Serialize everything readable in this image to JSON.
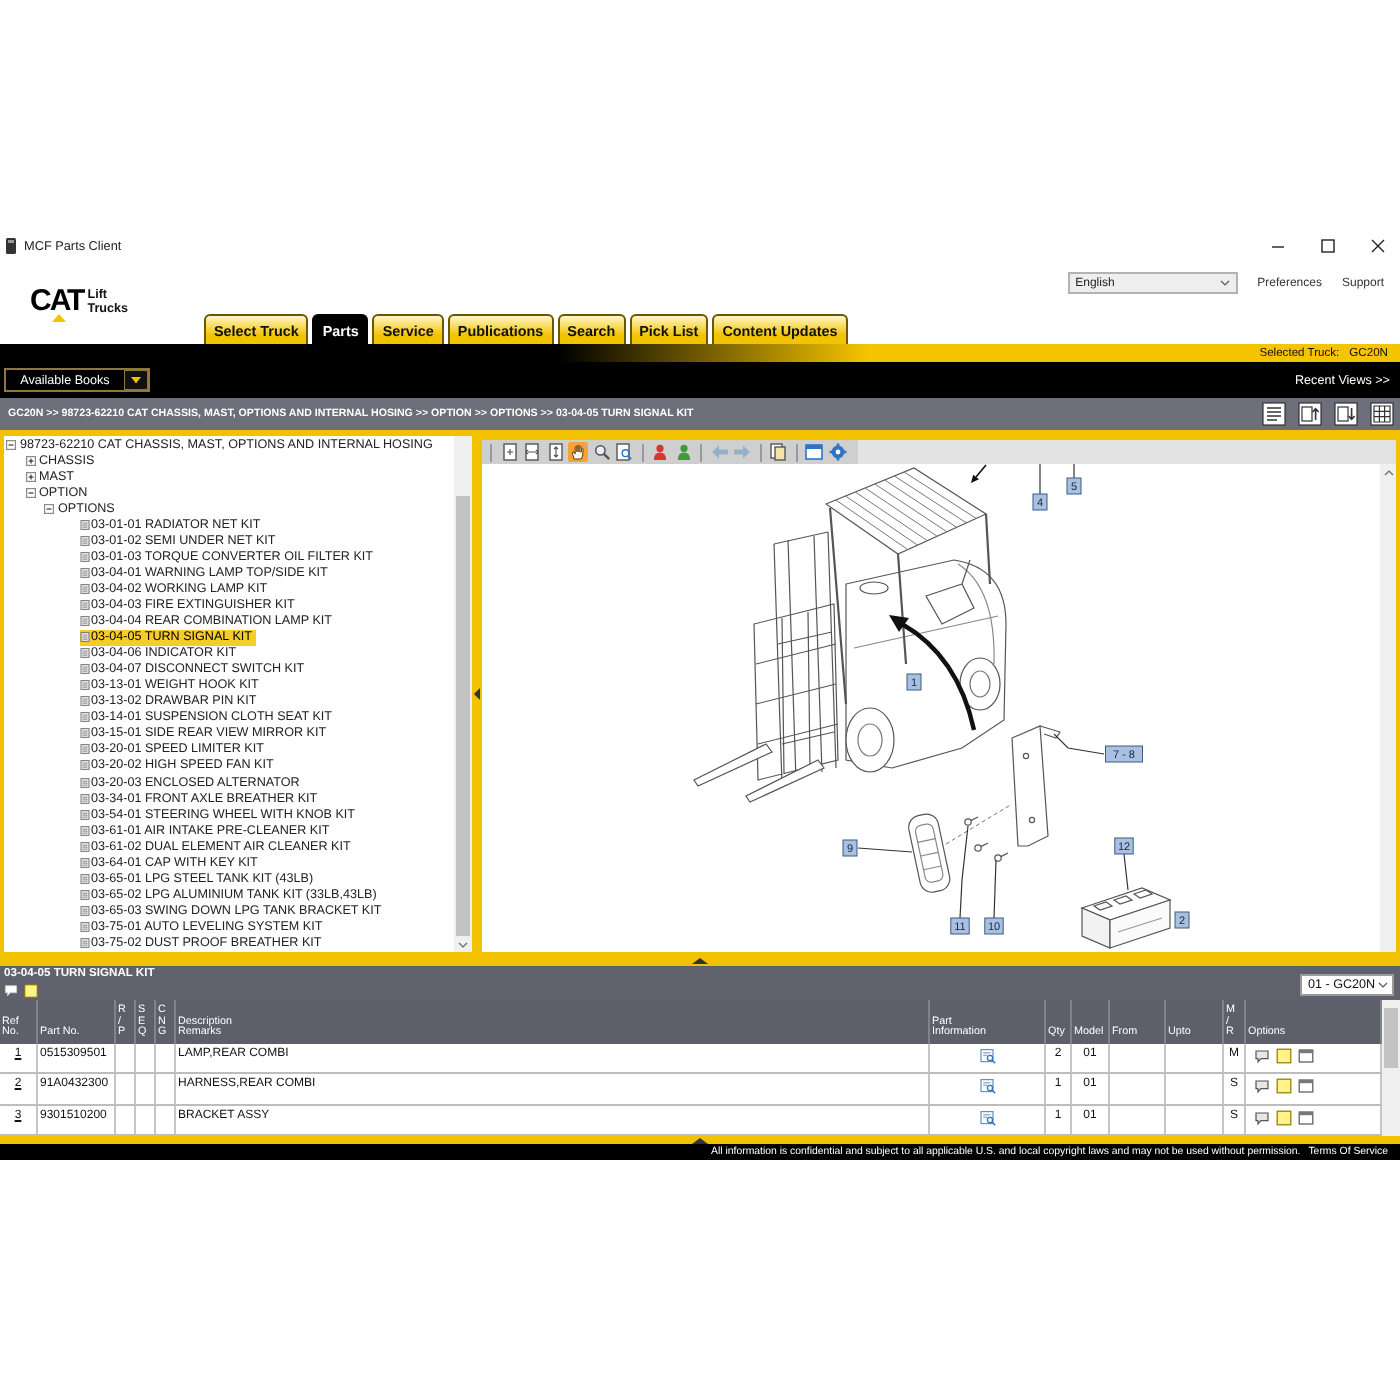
{
  "window": {
    "title": "MCF Parts Client"
  },
  "header": {
    "logo": {
      "mark": "CAT",
      "lines": [
        "Lift",
        "Trucks"
      ]
    },
    "language": "English",
    "links": [
      "Preferences",
      "Support"
    ]
  },
  "tabs": [
    {
      "label": "Select Truck",
      "selected": false
    },
    {
      "label": "Parts",
      "selected": true
    },
    {
      "label": "Service",
      "selected": false
    },
    {
      "label": "Publications",
      "selected": false
    },
    {
      "label": "Search",
      "selected": false
    },
    {
      "label": "Pick List",
      "selected": false
    },
    {
      "label": "Content Updates",
      "selected": false
    }
  ],
  "selected_truck": {
    "label": "Selected Truck:",
    "value": "GC20N"
  },
  "books_dropdown": {
    "label": "Available Books"
  },
  "recent_views": "Recent Views >>",
  "breadcrumb": "GC20N >> 98723-62210 CAT CHASSIS, MAST, OPTIONS AND INTERNAL HOSING >> OPTION >> OPTIONS >> 03-04-05 TURN SIGNAL KIT",
  "tree": [
    {
      "kind": "folder",
      "label": "98723-62210 CAT CHASSIS, MAST, OPTIONS AND INTERNAL HOSING",
      "expanded": true,
      "selected": false,
      "children": [
        {
          "kind": "folder",
          "label": "CHASSIS",
          "expanded": false,
          "selected": false
        },
        {
          "kind": "folder",
          "label": "MAST",
          "expanded": false,
          "selected": false
        },
        {
          "kind": "folder",
          "label": "OPTION",
          "expanded": true,
          "selected": false,
          "children": [
            {
              "kind": "folder",
              "label": "OPTIONS",
              "expanded": true,
              "selected": false,
              "children": [
                {
                  "kind": "item",
                  "label": "03-01-01 RADIATOR NET KIT",
                  "selected": false
                },
                {
                  "kind": "item",
                  "label": "03-01-02 SEMI UNDER NET KIT",
                  "selected": false
                },
                {
                  "kind": "item",
                  "label": "03-01-03 TORQUE CONVERTER OIL FILTER KIT",
                  "selected": false
                },
                {
                  "kind": "item",
                  "label": "03-04-01 WARNING LAMP TOP/SIDE KIT",
                  "selected": false
                },
                {
                  "kind": "item",
                  "label": "03-04-02 WORKING LAMP KIT",
                  "selected": false
                },
                {
                  "kind": "item",
                  "label": "03-04-03 FIRE EXTINGUISHER KIT",
                  "selected": false
                },
                {
                  "kind": "item",
                  "label": "03-04-04 REAR COMBINATION LAMP KIT",
                  "selected": false
                },
                {
                  "kind": "item",
                  "label": "03-04-05 TURN SIGNAL KIT",
                  "selected": true
                },
                {
                  "kind": "item",
                  "label": "03-04-06 INDICATOR KIT",
                  "selected": false
                },
                {
                  "kind": "item",
                  "label": "03-04-07 DISCONNECT SWITCH KIT",
                  "selected": false
                },
                {
                  "kind": "item",
                  "label": "03-13-01 WEIGHT HOOK KIT",
                  "selected": false
                },
                {
                  "kind": "item",
                  "label": "03-13-02 DRAWBAR PIN KIT",
                  "selected": false
                },
                {
                  "kind": "item",
                  "label": "03-14-01 SUSPENSION CLOTH SEAT KIT",
                  "selected": false
                },
                {
                  "kind": "item",
                  "label": "03-15-01 SIDE REAR VIEW MIRROR KIT",
                  "selected": false
                },
                {
                  "kind": "item",
                  "label": "03-20-01 SPEED LIMITER KIT",
                  "selected": false
                },
                {
                  "kind": "item",
                  "label": "03-20-02 HIGH SPEED FAN KIT",
                  "selected": false
                },
                {
                  "kind": "item",
                  "label": "03-20-03 ENCLOSED ALTERNATOR",
                  "selected": false
                },
                {
                  "kind": "item",
                  "label": "03-34-01 FRONT AXLE BREATHER KIT",
                  "selected": false
                },
                {
                  "kind": "item",
                  "label": "03-54-01 STEERING WHEEL WITH KNOB KIT",
                  "selected": false
                },
                {
                  "kind": "item",
                  "label": "03-61-01 AIR INTAKE PRE-CLEANER KIT",
                  "selected": false
                },
                {
                  "kind": "item",
                  "label": "03-61-02 DUAL ELEMENT AIR CLEANER KIT",
                  "selected": false
                },
                {
                  "kind": "item",
                  "label": "03-64-01 CAP WITH KEY KIT",
                  "selected": false
                },
                {
                  "kind": "item",
                  "label": "03-65-01 LPG STEEL TANK KIT (43LB)",
                  "selected": false
                },
                {
                  "kind": "item",
                  "label": "03-65-02 LPG ALUMINIUM TANK KIT (33LB,43LB)",
                  "selected": false
                },
                {
                  "kind": "item",
                  "label": "03-65-03 SWING DOWN LPG TANK BRACKET KIT",
                  "selected": false
                },
                {
                  "kind": "item",
                  "label": "03-75-01 AUTO LEVELING SYSTEM KIT",
                  "selected": false
                },
                {
                  "kind": "item",
                  "label": "03-75-02 DUST PROOF BREATHER KIT",
                  "selected": false
                }
              ]
            }
          ]
        }
      ]
    }
  ],
  "diagram": {
    "toolbar": [
      {
        "kind": "page-fit",
        "selected": false,
        "disabled": false
      },
      {
        "kind": "page-width",
        "selected": false,
        "disabled": false
      },
      {
        "kind": "page-height",
        "selected": false,
        "disabled": false
      },
      {
        "kind": "pan",
        "selected": true,
        "disabled": false
      },
      {
        "kind": "zoom",
        "selected": false,
        "disabled": false
      },
      {
        "kind": "zoom-box",
        "selected": false,
        "disabled": false
      },
      {
        "kind": "mark-red",
        "selected": false,
        "disabled": false
      },
      {
        "kind": "mark-green",
        "selected": false,
        "disabled": false
      },
      {
        "kind": "back",
        "selected": false,
        "disabled": true
      },
      {
        "kind": "forward",
        "selected": false,
        "disabled": true
      },
      {
        "kind": "copy",
        "selected": false,
        "disabled": false
      },
      {
        "kind": "window",
        "selected": false,
        "disabled": false
      },
      {
        "kind": "options",
        "selected": false,
        "disabled": false
      }
    ],
    "callouts": [
      "5",
      "4",
      "1",
      "7 - 8",
      "12",
      "9",
      "2",
      "11",
      "10"
    ]
  },
  "parts_panel": {
    "title": "03-04-05 TURN SIGNAL KIT",
    "model_select": "01 - GC20N",
    "columns": [
      "Ref\nNo.",
      "Part No.",
      "R\n/\nP",
      "S\nE\nQ",
      "C\nN\nG",
      "Description\nRemarks",
      "Part\nInformation",
      "Qty",
      "Model",
      "From",
      "Upto",
      "M\n/\nR",
      "Options"
    ],
    "rows": [
      {
        "ref_no": "1",
        "part_no": "0515309501",
        "description": "LAMP,REAR COMBI",
        "qty": "2",
        "model": "01",
        "m_r": "M"
      },
      {
        "ref_no": "2",
        "part_no": "91A0432300",
        "description": "HARNESS,REAR COMBI",
        "qty": "1",
        "model": "01",
        "m_r": "S"
      },
      {
        "ref_no": "3",
        "part_no": "9301510200",
        "description": "BRACKET ASSY",
        "qty": "1",
        "model": "01",
        "m_r": "S"
      }
    ]
  },
  "footer": {
    "notice": "All information is confidential and subject to all applicable U.S. and local copyright laws and may not be used without permission.",
    "link": "Terms Of Service"
  }
}
